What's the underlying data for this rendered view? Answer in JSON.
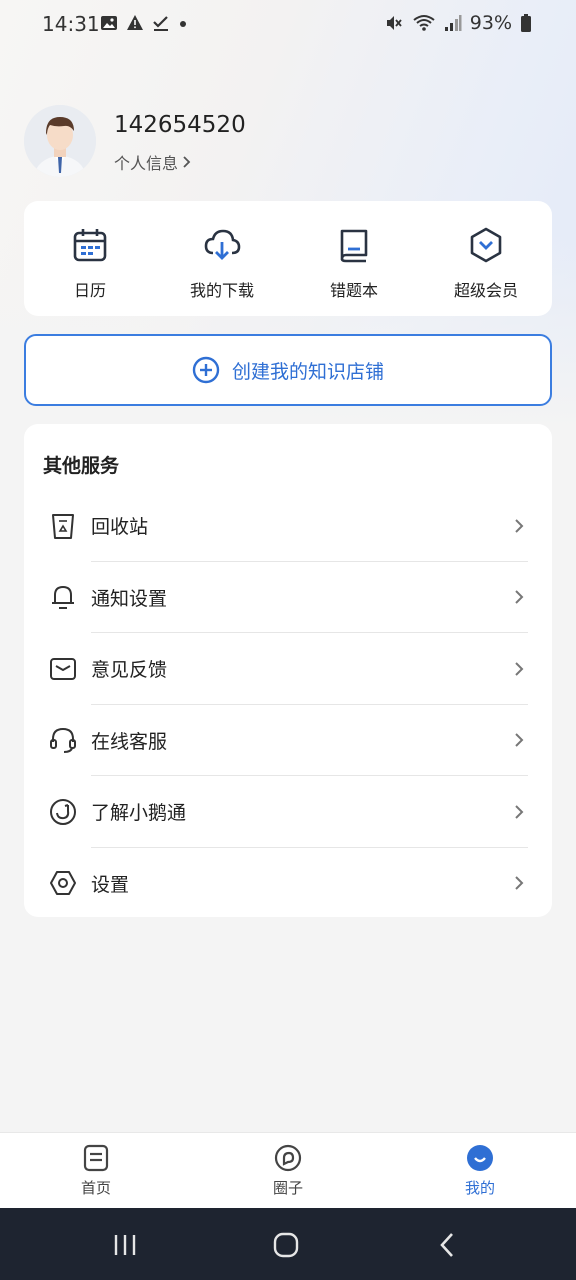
{
  "status_bar": {
    "time": "14:31",
    "battery": "93%",
    "left_icons": [
      "image-icon",
      "warning-icon",
      "check-icon",
      "dot-icon"
    ],
    "right_icons": [
      "mute-icon",
      "wifi-icon",
      "signal-icon",
      "battery-icon"
    ]
  },
  "profile": {
    "user_id": "142654520",
    "info_link": "个人信息"
  },
  "quick_actions": [
    {
      "label": "日历",
      "icon": "calendar-icon"
    },
    {
      "label": "我的下载",
      "icon": "download-icon"
    },
    {
      "label": "错题本",
      "icon": "notebook-icon"
    },
    {
      "label": "超级会员",
      "icon": "vip-icon"
    }
  ],
  "create_shop": {
    "label": "创建我的知识店铺",
    "icon": "plus-circle-icon"
  },
  "services": {
    "title": "其他服务",
    "items": [
      {
        "label": "回收站",
        "icon": "recycle-icon"
      },
      {
        "label": "通知设置",
        "icon": "bell-icon"
      },
      {
        "label": "意见反馈",
        "icon": "mail-icon"
      },
      {
        "label": "在线客服",
        "icon": "headset-icon"
      },
      {
        "label": "了解小鹅通",
        "icon": "brand-icon"
      },
      {
        "label": "设置",
        "icon": "settings-icon"
      }
    ]
  },
  "tabs": [
    {
      "label": "首页",
      "icon": "home-doc-icon",
      "active": false
    },
    {
      "label": "圈子",
      "icon": "circle-icon",
      "active": false
    },
    {
      "label": "我的",
      "icon": "profile-icon",
      "active": true
    }
  ],
  "colors": {
    "accent": "#2f6fd4",
    "icon_dark": "#2a3342",
    "system_nav": "#1e2430"
  }
}
